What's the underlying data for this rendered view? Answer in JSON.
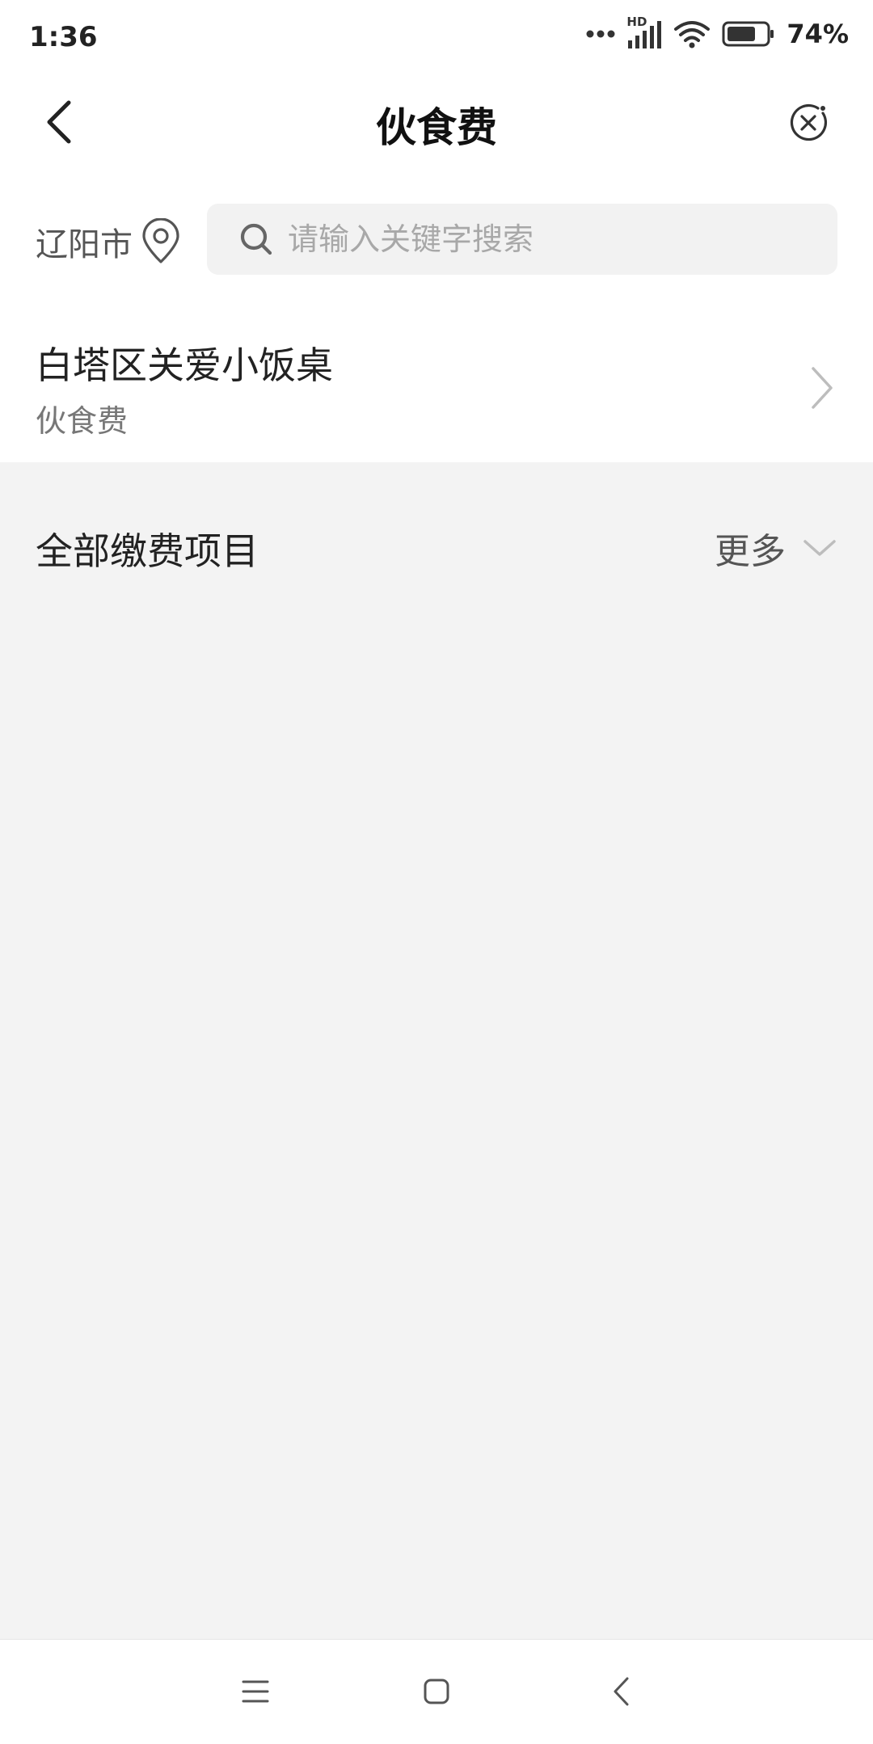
{
  "status_bar": {
    "time": "1:36",
    "network_label": "HD",
    "battery_percent": "74%"
  },
  "header": {
    "title": "伙食费",
    "back_icon": "chevron-left-icon",
    "close_icon": "close-circle-icon"
  },
  "location": {
    "city": "辽阳市",
    "icon": "location-pin-icon"
  },
  "search": {
    "placeholder": "请输入关键字搜索",
    "value": ""
  },
  "results": [
    {
      "title": "白塔区关爱小饭桌",
      "subtitle": "伙食费"
    }
  ],
  "section": {
    "title": "全部缴费项目",
    "more_label": "更多"
  },
  "navbar": {
    "menu_icon": "menu-icon",
    "home_icon": "home-square-icon",
    "back_icon": "back-triangle-icon"
  },
  "colors": {
    "background": "#f3f3f3",
    "surface": "#ffffff",
    "search_bg": "#f2f2f2",
    "text_primary": "#222222",
    "text_secondary": "#777777",
    "placeholder": "#a8a8a8"
  }
}
